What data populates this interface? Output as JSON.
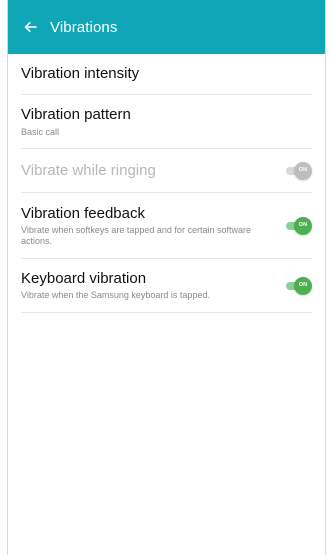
{
  "header": {
    "title": "Vibrations",
    "back_icon": "arrow-left-icon"
  },
  "settings": [
    {
      "title": "Vibration intensity",
      "subtitle": "",
      "toggle": null,
      "enabled": true
    },
    {
      "title": "Vibration pattern",
      "subtitle": "Basic call",
      "toggle": null,
      "enabled": true
    },
    {
      "title": "Vibrate while ringing",
      "subtitle": "",
      "toggle": {
        "state": "ON",
        "enabled": false
      },
      "enabled": false
    },
    {
      "title": "Vibration feedback",
      "subtitle": "Vibrate when softkeys are tapped and for certain software actions.",
      "toggle": {
        "state": "ON",
        "enabled": true
      },
      "enabled": true
    },
    {
      "title": "Keyboard vibration",
      "subtitle": "Vibrate when the Samsung keyboard is tapped.",
      "toggle": {
        "state": "ON",
        "enabled": true
      },
      "enabled": true
    }
  ],
  "colors": {
    "header_bg": "#0fa7b8",
    "toggle_on": "#4caf50",
    "toggle_off": "#bdbdbd"
  }
}
